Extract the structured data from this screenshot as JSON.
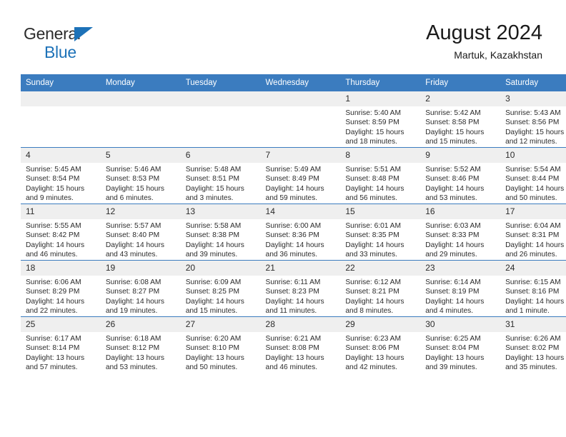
{
  "brand": {
    "line1": "General",
    "line2": "Blue",
    "triangle_color": "#1d72b8"
  },
  "header": {
    "title": "August 2024",
    "subtitle": "Martuk, Kazakhstan"
  },
  "theme": {
    "header_bg": "#3b7cbf",
    "header_text": "#ffffff",
    "daynum_bg": "#efefef",
    "cell_bg": "#ffffff",
    "rule_color": "#3b7cbf"
  },
  "labels": {
    "sunrise_prefix": "Sunrise:",
    "sunset_prefix": "Sunset:",
    "daylight_prefix": "Daylight:"
  },
  "weekday_headers": [
    "Sunday",
    "Monday",
    "Tuesday",
    "Wednesday",
    "Thursday",
    "Friday",
    "Saturday"
  ],
  "weeks": [
    [
      {
        "day": "",
        "l1": "",
        "l2": "",
        "l3": "",
        "l4": ""
      },
      {
        "day": "",
        "l1": "",
        "l2": "",
        "l3": "",
        "l4": ""
      },
      {
        "day": "",
        "l1": "",
        "l2": "",
        "l3": "",
        "l4": ""
      },
      {
        "day": "",
        "l1": "",
        "l2": "",
        "l3": "",
        "l4": ""
      },
      {
        "day": "1",
        "l1": "Sunrise: 5:40 AM",
        "l2": "Sunset: 8:59 PM",
        "l3": "Daylight: 15 hours",
        "l4": "and 18 minutes."
      },
      {
        "day": "2",
        "l1": "Sunrise: 5:42 AM",
        "l2": "Sunset: 8:58 PM",
        "l3": "Daylight: 15 hours",
        "l4": "and 15 minutes."
      },
      {
        "day": "3",
        "l1": "Sunrise: 5:43 AM",
        "l2": "Sunset: 8:56 PM",
        "l3": "Daylight: 15 hours",
        "l4": "and 12 minutes."
      }
    ],
    [
      {
        "day": "4",
        "l1": "Sunrise: 5:45 AM",
        "l2": "Sunset: 8:54 PM",
        "l3": "Daylight: 15 hours",
        "l4": "and 9 minutes."
      },
      {
        "day": "5",
        "l1": "Sunrise: 5:46 AM",
        "l2": "Sunset: 8:53 PM",
        "l3": "Daylight: 15 hours",
        "l4": "and 6 minutes."
      },
      {
        "day": "6",
        "l1": "Sunrise: 5:48 AM",
        "l2": "Sunset: 8:51 PM",
        "l3": "Daylight: 15 hours",
        "l4": "and 3 minutes."
      },
      {
        "day": "7",
        "l1": "Sunrise: 5:49 AM",
        "l2": "Sunset: 8:49 PM",
        "l3": "Daylight: 14 hours",
        "l4": "and 59 minutes."
      },
      {
        "day": "8",
        "l1": "Sunrise: 5:51 AM",
        "l2": "Sunset: 8:48 PM",
        "l3": "Daylight: 14 hours",
        "l4": "and 56 minutes."
      },
      {
        "day": "9",
        "l1": "Sunrise: 5:52 AM",
        "l2": "Sunset: 8:46 PM",
        "l3": "Daylight: 14 hours",
        "l4": "and 53 minutes."
      },
      {
        "day": "10",
        "l1": "Sunrise: 5:54 AM",
        "l2": "Sunset: 8:44 PM",
        "l3": "Daylight: 14 hours",
        "l4": "and 50 minutes."
      }
    ],
    [
      {
        "day": "11",
        "l1": "Sunrise: 5:55 AM",
        "l2": "Sunset: 8:42 PM",
        "l3": "Daylight: 14 hours",
        "l4": "and 46 minutes."
      },
      {
        "day": "12",
        "l1": "Sunrise: 5:57 AM",
        "l2": "Sunset: 8:40 PM",
        "l3": "Daylight: 14 hours",
        "l4": "and 43 minutes."
      },
      {
        "day": "13",
        "l1": "Sunrise: 5:58 AM",
        "l2": "Sunset: 8:38 PM",
        "l3": "Daylight: 14 hours",
        "l4": "and 39 minutes."
      },
      {
        "day": "14",
        "l1": "Sunrise: 6:00 AM",
        "l2": "Sunset: 8:36 PM",
        "l3": "Daylight: 14 hours",
        "l4": "and 36 minutes."
      },
      {
        "day": "15",
        "l1": "Sunrise: 6:01 AM",
        "l2": "Sunset: 8:35 PM",
        "l3": "Daylight: 14 hours",
        "l4": "and 33 minutes."
      },
      {
        "day": "16",
        "l1": "Sunrise: 6:03 AM",
        "l2": "Sunset: 8:33 PM",
        "l3": "Daylight: 14 hours",
        "l4": "and 29 minutes."
      },
      {
        "day": "17",
        "l1": "Sunrise: 6:04 AM",
        "l2": "Sunset: 8:31 PM",
        "l3": "Daylight: 14 hours",
        "l4": "and 26 minutes."
      }
    ],
    [
      {
        "day": "18",
        "l1": "Sunrise: 6:06 AM",
        "l2": "Sunset: 8:29 PM",
        "l3": "Daylight: 14 hours",
        "l4": "and 22 minutes."
      },
      {
        "day": "19",
        "l1": "Sunrise: 6:08 AM",
        "l2": "Sunset: 8:27 PM",
        "l3": "Daylight: 14 hours",
        "l4": "and 19 minutes."
      },
      {
        "day": "20",
        "l1": "Sunrise: 6:09 AM",
        "l2": "Sunset: 8:25 PM",
        "l3": "Daylight: 14 hours",
        "l4": "and 15 minutes."
      },
      {
        "day": "21",
        "l1": "Sunrise: 6:11 AM",
        "l2": "Sunset: 8:23 PM",
        "l3": "Daylight: 14 hours",
        "l4": "and 11 minutes."
      },
      {
        "day": "22",
        "l1": "Sunrise: 6:12 AM",
        "l2": "Sunset: 8:21 PM",
        "l3": "Daylight: 14 hours",
        "l4": "and 8 minutes."
      },
      {
        "day": "23",
        "l1": "Sunrise: 6:14 AM",
        "l2": "Sunset: 8:19 PM",
        "l3": "Daylight: 14 hours",
        "l4": "and 4 minutes."
      },
      {
        "day": "24",
        "l1": "Sunrise: 6:15 AM",
        "l2": "Sunset: 8:16 PM",
        "l3": "Daylight: 14 hours",
        "l4": "and 1 minute."
      }
    ],
    [
      {
        "day": "25",
        "l1": "Sunrise: 6:17 AM",
        "l2": "Sunset: 8:14 PM",
        "l3": "Daylight: 13 hours",
        "l4": "and 57 minutes."
      },
      {
        "day": "26",
        "l1": "Sunrise: 6:18 AM",
        "l2": "Sunset: 8:12 PM",
        "l3": "Daylight: 13 hours",
        "l4": "and 53 minutes."
      },
      {
        "day": "27",
        "l1": "Sunrise: 6:20 AM",
        "l2": "Sunset: 8:10 PM",
        "l3": "Daylight: 13 hours",
        "l4": "and 50 minutes."
      },
      {
        "day": "28",
        "l1": "Sunrise: 6:21 AM",
        "l2": "Sunset: 8:08 PM",
        "l3": "Daylight: 13 hours",
        "l4": "and 46 minutes."
      },
      {
        "day": "29",
        "l1": "Sunrise: 6:23 AM",
        "l2": "Sunset: 8:06 PM",
        "l3": "Daylight: 13 hours",
        "l4": "and 42 minutes."
      },
      {
        "day": "30",
        "l1": "Sunrise: 6:25 AM",
        "l2": "Sunset: 8:04 PM",
        "l3": "Daylight: 13 hours",
        "l4": "and 39 minutes."
      },
      {
        "day": "31",
        "l1": "Sunrise: 6:26 AM",
        "l2": "Sunset: 8:02 PM",
        "l3": "Daylight: 13 hours",
        "l4": "and 35 minutes."
      }
    ]
  ]
}
